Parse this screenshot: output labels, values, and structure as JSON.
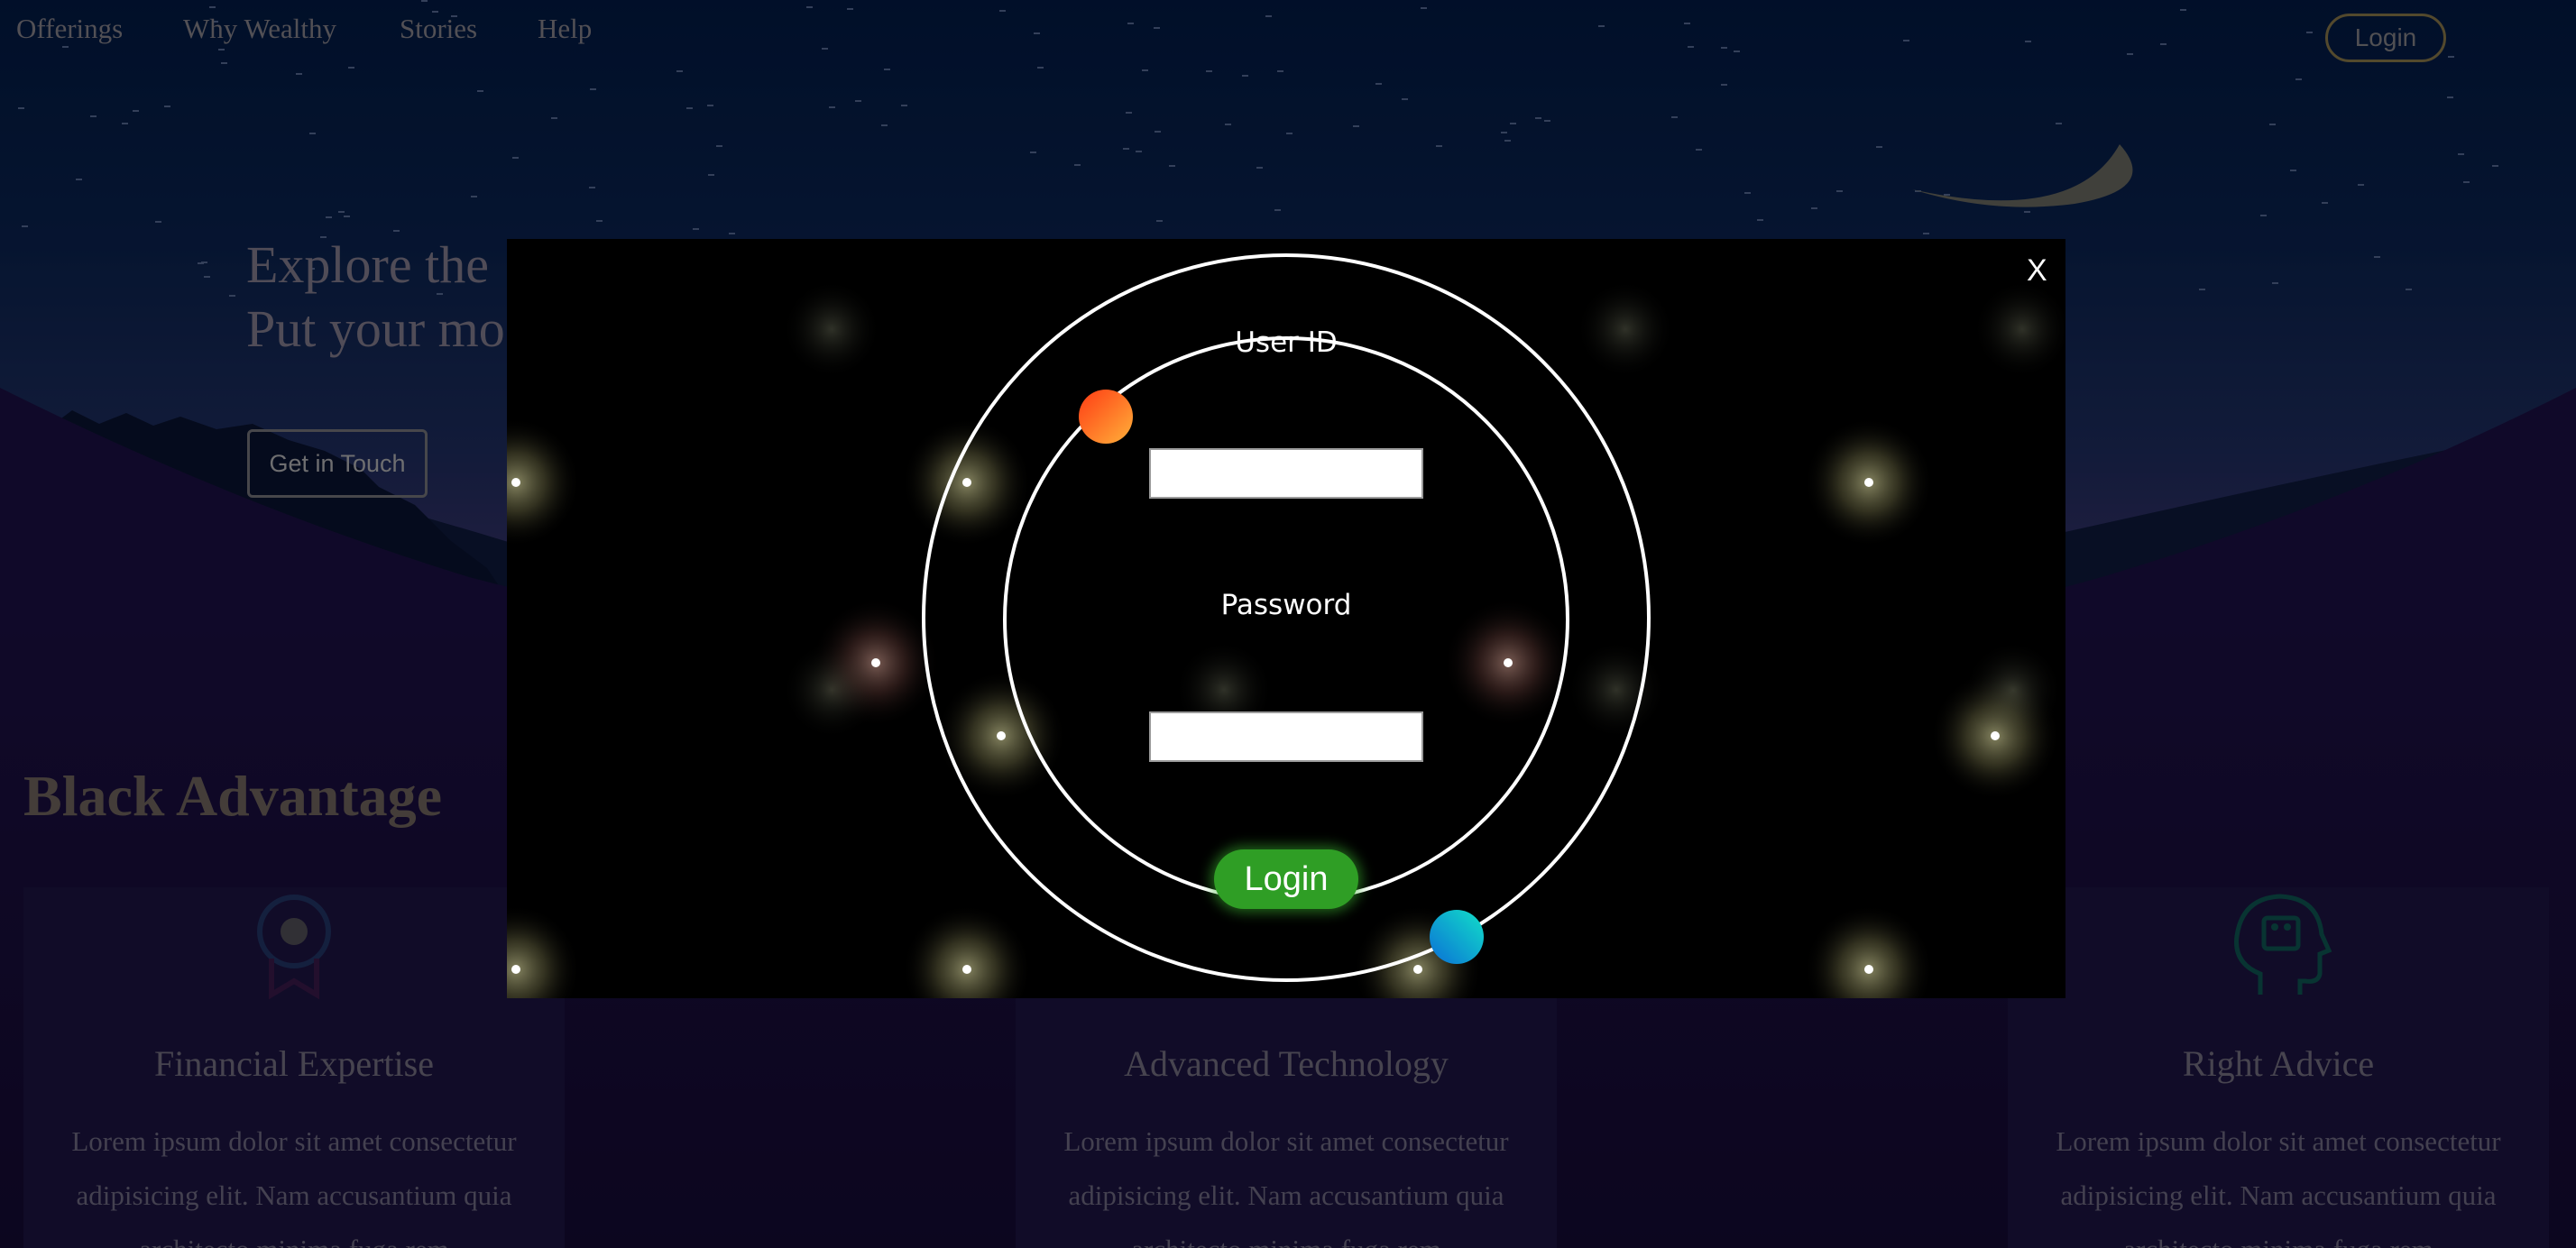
{
  "nav": {
    "items": [
      "Offerings",
      "Why Wealthy",
      "Stories",
      "Help"
    ],
    "login_label": "Login"
  },
  "hero": {
    "line1": "Explore the",
    "line2": "Put your mo",
    "cta_label": "Get in Touch"
  },
  "section": {
    "title": "Black Advantage"
  },
  "cards": [
    {
      "title": "Financial Expertise",
      "text": "Lorem ipsum dolor sit amet consectetur adipisicing elit. Nam accusantium quia architecto minima fuga rem",
      "icon": "award-ribbon-icon"
    },
    {
      "title": "Advanced Technology",
      "text": "Lorem ipsum dolor sit amet consectetur adipisicing elit. Nam accusantium quia architecto minima fuga rem",
      "icon": "technology-icon"
    },
    {
      "title": "Right Advice",
      "text": "Lorem ipsum dolor sit amet consectetur adipisicing elit. Nam accusantium quia architecto minima fuga rem",
      "icon": "head-gear-icon"
    }
  ],
  "modal": {
    "close_label": "X",
    "userid_label": "User ID",
    "userid_value": "",
    "password_label": "Password",
    "password_value": "",
    "login_label": "Login"
  },
  "colors": {
    "login_green": "#2f9e25",
    "orb_orange": "#ff6a1a",
    "orb_cyan": "#11c3d8",
    "modal_bg": "#000000"
  }
}
